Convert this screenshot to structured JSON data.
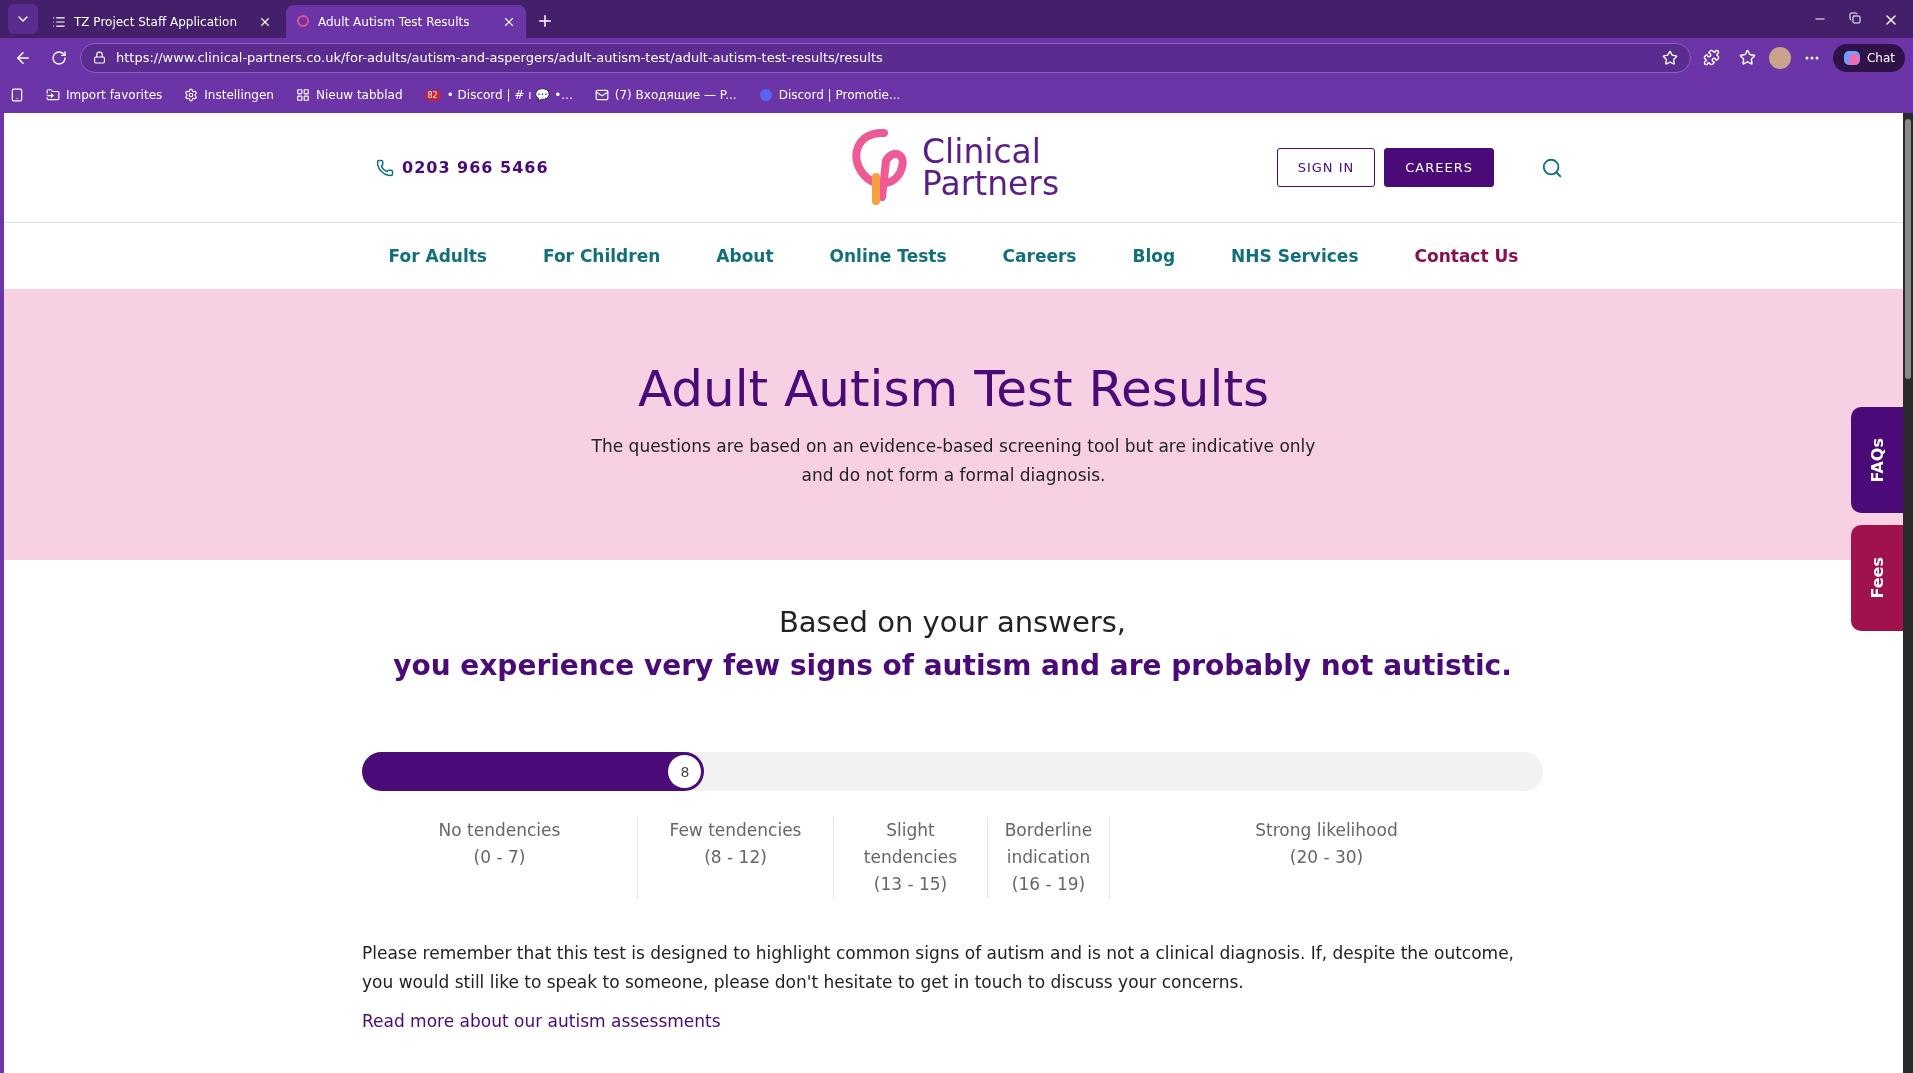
{
  "browser": {
    "tabs": [
      {
        "title": "TZ Project Staff Application",
        "selected": false
      },
      {
        "title": "Adult Autism Test Results",
        "selected": true
      }
    ],
    "address": "https://www.clinical-partners.co.uk/for-adults/autism-and-aspergers/adult-autism-test/adult-autism-test-results/results",
    "bookmarks": [
      "Import favorites",
      "Instellingen",
      "Nieuw tabblad",
      "• Discord | # ı 💬 •...",
      "(7) Входящие — P...",
      "Discord | Promotie..."
    ],
    "bookmark_badge": "82",
    "chat_label": "Chat"
  },
  "header": {
    "phone": "0203 966 5466",
    "logo": [
      "Clinical",
      "Partners"
    ],
    "sign_in": "SIGN IN",
    "careers": "CAREERS"
  },
  "nav": [
    {
      "label": "For Adults",
      "highlight": false
    },
    {
      "label": "For Children",
      "highlight": false
    },
    {
      "label": "About",
      "highlight": false
    },
    {
      "label": "Online Tests",
      "highlight": false
    },
    {
      "label": "Careers",
      "highlight": false
    },
    {
      "label": "Blog",
      "highlight": false
    },
    {
      "label": "NHS Services",
      "highlight": false
    },
    {
      "label": "Contact Us",
      "highlight": true
    }
  ],
  "hero": {
    "title": "Adult Autism Test Results",
    "subtitle": [
      "The questions are based on an evidence-based screening tool but are indicative only",
      "and do not form a formal diagnosis."
    ]
  },
  "result": {
    "intro": "Based on your answers,",
    "verdict": "you experience very few signs of autism and are probably not autistic.",
    "score": "8",
    "level": 0.29
  },
  "scale": [
    {
      "label": "No tendencies",
      "range": "(0 - 7)"
    },
    {
      "label": "Few tendencies",
      "range": "(8 - 12)"
    },
    {
      "label": "Slight tendencies",
      "range": "(13 - 15)"
    },
    {
      "label": "Borderline indication",
      "range": "(16 - 19)"
    },
    {
      "label": "Strong likelihood",
      "range": "(20 - 30)"
    }
  ],
  "note": "Please remember that this test is designed to highlight common signs of autism and is not a clinical diagnosis. If, despite the outcome, you would still like to speak to someone, please don't hesitate to get in touch to discuss your concerns.",
  "link": "Read more about our autism assessments",
  "side_tabs": [
    {
      "label": "FAQs",
      "color": "#4a0a78"
    },
    {
      "label": "Fees",
      "color": "#a0124e"
    }
  ]
}
